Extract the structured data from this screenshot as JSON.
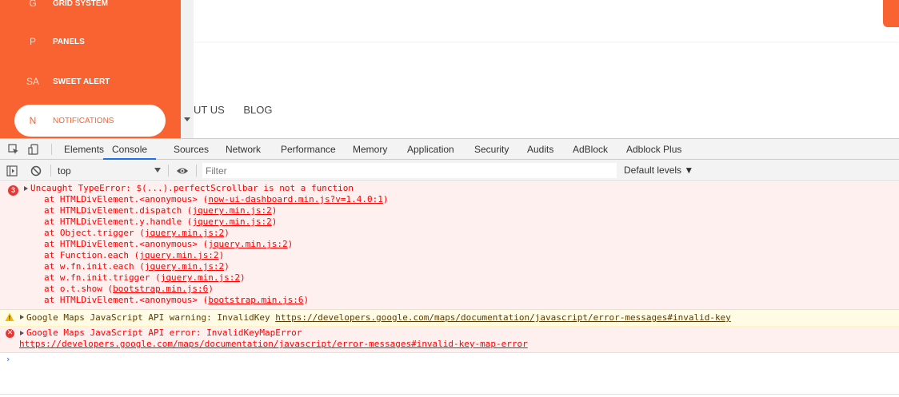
{
  "sidebar": {
    "items": [
      {
        "abbr": "G",
        "label": "GRID SYSTEM"
      },
      {
        "abbr": "P",
        "label": "PANELS"
      },
      {
        "abbr": "SA",
        "label": "SWEET ALERT"
      }
    ],
    "active": {
      "abbr": "N",
      "label": "NOTIFICATIONS"
    }
  },
  "page_menu": {
    "about": "UT US",
    "blog": "BLOG"
  },
  "devtools": {
    "tabs": [
      "Elements",
      "Console",
      "Sources",
      "Network",
      "Performance",
      "Memory",
      "Application",
      "Security",
      "Audits",
      "AdBlock",
      "Adblock Plus"
    ],
    "active_tab": "Console",
    "context": "top",
    "filter_placeholder": "Filter",
    "levels_label": "Default levels ▼",
    "error_count": "3"
  },
  "console": {
    "error1": {
      "message": "Uncaught TypeError: $(...).perfectScrollbar is not a function",
      "stack": [
        {
          "text": "at HTMLDivElement.<anonymous> (",
          "link": "now-ui-dashboard.min.js?v=1.4.0:1",
          "end": ")"
        },
        {
          "text": "at HTMLDivElement.dispatch (",
          "link": "jquery.min.js:2",
          "end": ")"
        },
        {
          "text": "at HTMLDivElement.y.handle (",
          "link": "jquery.min.js:2",
          "end": ")"
        },
        {
          "text": "at Object.trigger (",
          "link": "jquery.min.js:2",
          "end": ")"
        },
        {
          "text": "at HTMLDivElement.<anonymous> (",
          "link": "jquery.min.js:2",
          "end": ")"
        },
        {
          "text": "at Function.each (",
          "link": "jquery.min.js:2",
          "end": ")"
        },
        {
          "text": "at w.fn.init.each (",
          "link": "jquery.min.js:2",
          "end": ")"
        },
        {
          "text": "at w.fn.init.trigger (",
          "link": "jquery.min.js:2",
          "end": ")"
        },
        {
          "text": "at o.t.show (",
          "link": "bootstrap.min.js:6",
          "end": ")"
        },
        {
          "text": "at HTMLDivElement.<anonymous> (",
          "link": "bootstrap.min.js:6",
          "end": ")"
        }
      ]
    },
    "warning": {
      "message": "Google Maps JavaScript API warning: InvalidKey ",
      "link": "https://developers.google.com/maps/documentation/javascript/error-messages#invalid-key"
    },
    "error2": {
      "message": "Google Maps JavaScript API error: InvalidKeyMapError",
      "link": "https://developers.google.com/maps/documentation/javascript/error-messages#invalid-key-map-error"
    },
    "prompt": "›"
  },
  "colors": {
    "sidebar_orange": "#f96332",
    "error_red": "#f00",
    "active_tab_blue": "#1a73e8"
  }
}
